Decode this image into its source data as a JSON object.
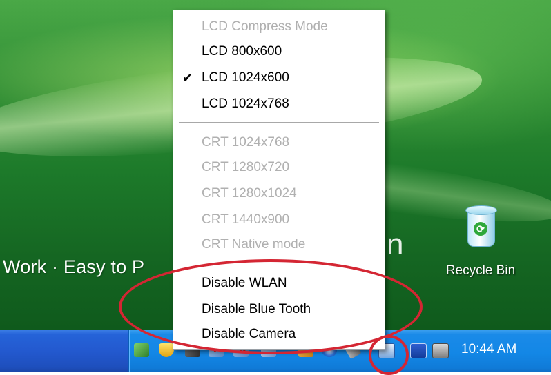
{
  "desktop": {
    "wallpaper_slogan": "Work · Easy to P",
    "wallpaper_fragment": "n",
    "recycle_bin": {
      "label": "Recycle Bin",
      "icon": "recycle-bin-icon"
    }
  },
  "context_menu": {
    "groups": [
      {
        "items": [
          {
            "label": "LCD Compress Mode",
            "enabled": false,
            "checked": false
          },
          {
            "label": "LCD 800x600",
            "enabled": true,
            "checked": false
          },
          {
            "label": "LCD 1024x600",
            "enabled": true,
            "checked": true
          },
          {
            "label": "LCD 1024x768",
            "enabled": true,
            "checked": false
          }
        ]
      },
      {
        "items": [
          {
            "label": "CRT 1024x768",
            "enabled": false,
            "checked": false
          },
          {
            "label": "CRT 1280x720",
            "enabled": false,
            "checked": false
          },
          {
            "label": "CRT 1280x1024",
            "enabled": false,
            "checked": false
          },
          {
            "label": "CRT 1440x900",
            "enabled": false,
            "checked": false
          },
          {
            "label": "CRT Native mode",
            "enabled": false,
            "checked": false
          }
        ]
      },
      {
        "items": [
          {
            "label": "Disable WLAN",
            "enabled": true,
            "checked": false
          },
          {
            "label": "Disable Blue Tooth",
            "enabled": true,
            "checked": false
          },
          {
            "label": "Disable Camera",
            "enabled": true,
            "checked": false
          }
        ]
      }
    ],
    "check_glyph": "✔"
  },
  "taskbar": {
    "clock": "10:44 AM",
    "tray_icons": [
      "network-icon",
      "security-shield-icon",
      "volume-icon",
      "network-disconnected-icon",
      "network-disconnected-icon",
      "bluetooth-icon",
      "update-icon",
      "wrench-icon",
      "display-settings-icon",
      "monitor-icon",
      "monitor-icon"
    ]
  },
  "annotation_color": "#d42633"
}
